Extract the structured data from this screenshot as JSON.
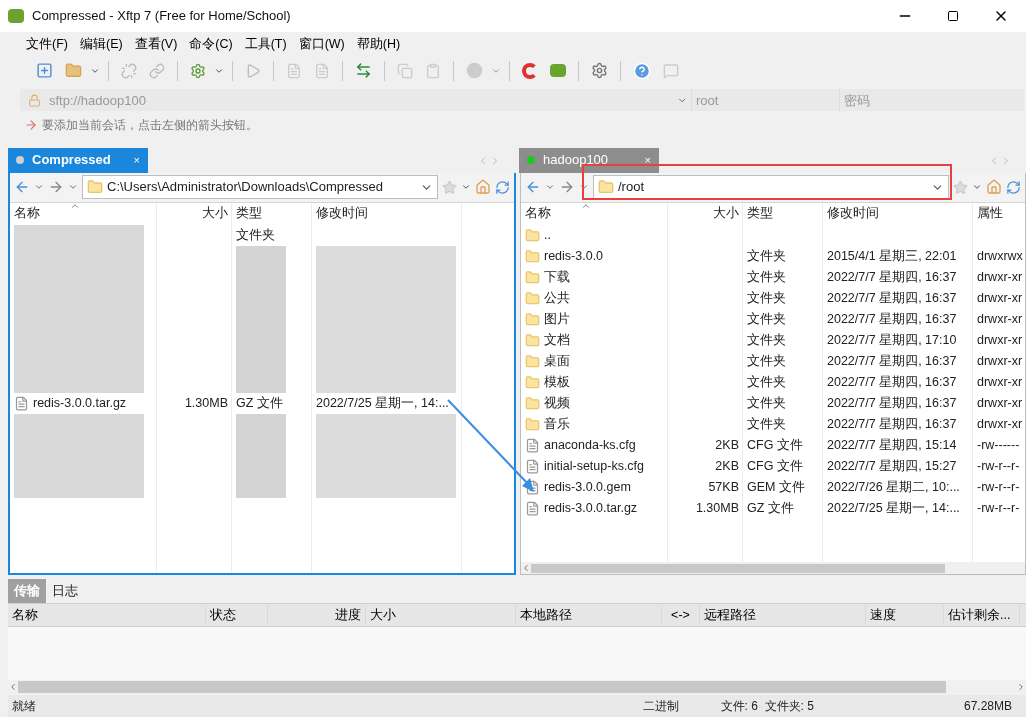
{
  "window": {
    "title": "Compressed - Xftp 7 (Free for Home/School)"
  },
  "menu": [
    "文件(F)",
    "编辑(E)",
    "查看(V)",
    "命令(C)",
    "工具(T)",
    "窗口(W)",
    "帮助(H)"
  ],
  "address": {
    "url": "sftp://hadoop100",
    "user": "root",
    "password_placeholder": "密码"
  },
  "hint": "要添加当前会话，点击左侧的箭头按钮。",
  "panes": [
    {
      "tab": {
        "label": "Compressed",
        "selected": true,
        "connected": false,
        "close": "×"
      },
      "path": "C:\\Users\\Administrator\\Downloads\\Compressed",
      "columns": [
        "名称",
        "大小",
        "类型",
        "修改时间"
      ],
      "rows": [
        {
          "kind": "blurred",
          "type": "文件夹"
        },
        {
          "kind": "blurred"
        },
        {
          "kind": "blurred"
        },
        {
          "kind": "blurred"
        },
        {
          "kind": "blurred"
        },
        {
          "kind": "blurred"
        },
        {
          "kind": "blurred"
        },
        {
          "kind": "blurred"
        },
        {
          "kind": "file",
          "name": "redis-3.0.0.tar.gz",
          "size": "1.30MB",
          "type": "GZ 文件",
          "modified": "2022/7/25 星期一, 14:..."
        },
        {
          "kind": "blurred"
        },
        {
          "kind": "blurred"
        },
        {
          "kind": "blurred"
        },
        {
          "kind": "blurred"
        }
      ]
    },
    {
      "tab": {
        "label": "hadoop100",
        "selected": false,
        "connected": true,
        "close": "×"
      },
      "path": "/root",
      "columns": [
        "名称",
        "大小",
        "类型",
        "修改时间",
        "属性"
      ],
      "rows": [
        {
          "kind": "parent",
          "name": ".."
        },
        {
          "kind": "folder",
          "name": "redis-3.0.0",
          "type": "文件夹",
          "modified": "2015/4/1 星期三, 22:01",
          "attrs": "drwxrwx"
        },
        {
          "kind": "folder",
          "name": "下载",
          "type": "文件夹",
          "modified": "2022/7/7 星期四, 16:37",
          "attrs": "drwxr-xr"
        },
        {
          "kind": "folder",
          "name": "公共",
          "type": "文件夹",
          "modified": "2022/7/7 星期四, 16:37",
          "attrs": "drwxr-xr"
        },
        {
          "kind": "folder",
          "name": "图片",
          "type": "文件夹",
          "modified": "2022/7/7 星期四, 16:37",
          "attrs": "drwxr-xr"
        },
        {
          "kind": "folder",
          "name": "文档",
          "type": "文件夹",
          "modified": "2022/7/7 星期四, 17:10",
          "attrs": "drwxr-xr"
        },
        {
          "kind": "folder",
          "name": "桌面",
          "type": "文件夹",
          "modified": "2022/7/7 星期四, 16:37",
          "attrs": "drwxr-xr"
        },
        {
          "kind": "folder",
          "name": "模板",
          "type": "文件夹",
          "modified": "2022/7/7 星期四, 16:37",
          "attrs": "drwxr-xr"
        },
        {
          "kind": "folder",
          "name": "视频",
          "type": "文件夹",
          "modified": "2022/7/7 星期四, 16:37",
          "attrs": "drwxr-xr"
        },
        {
          "kind": "folder",
          "name": "音乐",
          "type": "文件夹",
          "modified": "2022/7/7 星期四, 16:37",
          "attrs": "drwxr-xr"
        },
        {
          "kind": "file",
          "name": "anaconda-ks.cfg",
          "size": "2KB",
          "type": "CFG 文件",
          "modified": "2022/7/7 星期四, 15:14",
          "attrs": "-rw------"
        },
        {
          "kind": "file",
          "name": "initial-setup-ks.cfg",
          "size": "2KB",
          "type": "CFG 文件",
          "modified": "2022/7/7 星期四, 15:27",
          "attrs": "-rw-r--r-"
        },
        {
          "kind": "file",
          "name": "redis-3.0.0.gem",
          "size": "57KB",
          "type": "GEM 文件",
          "modified": "2022/7/26 星期二, 10:...",
          "attrs": "-rw-r--r-"
        },
        {
          "kind": "file",
          "name": "redis-3.0.0.tar.gz",
          "size": "1.30MB",
          "type": "GZ 文件",
          "modified": "2022/7/25 星期一, 14:...",
          "attrs": "-rw-r--r-"
        }
      ]
    }
  ],
  "bottom_tabs": [
    {
      "label": "传输",
      "selected": true
    },
    {
      "label": "日志",
      "selected": false
    }
  ],
  "transfer_columns": [
    "名称",
    "状态",
    "进度",
    "大小",
    "本地路径",
    "<->",
    "远程路径",
    "速度",
    "估计剩余..."
  ],
  "status_bar": {
    "state": "就绪",
    "mode": "二进制",
    "counts": "文件: 6  文件夹: 5",
    "size": "67.28MB"
  }
}
